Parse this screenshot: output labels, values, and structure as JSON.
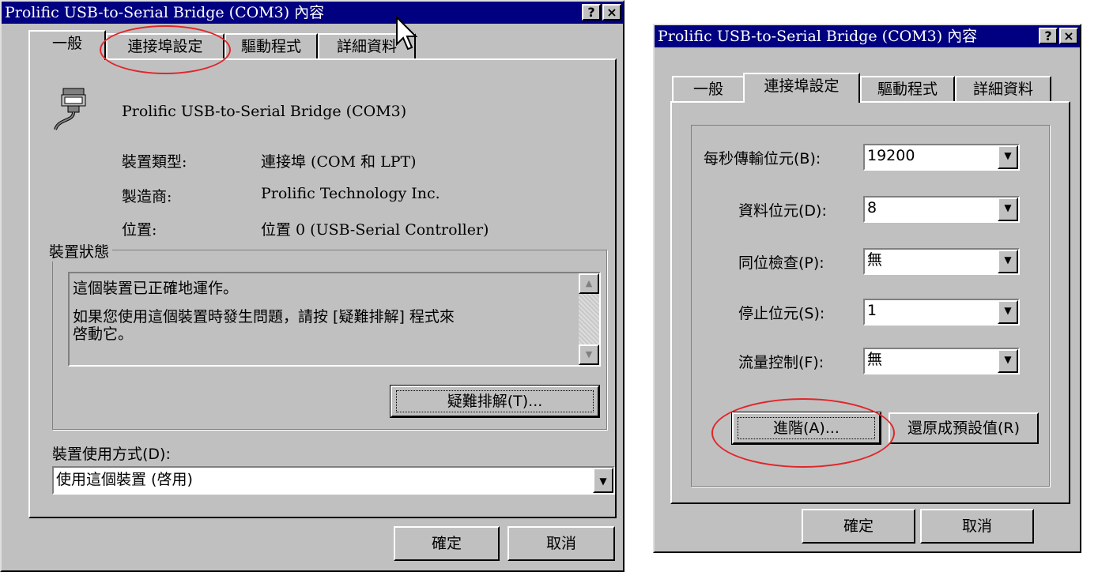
{
  "left": {
    "title": "Prolific USB-to-Serial Bridge (COM3) 內容",
    "help_btn": "?",
    "close_btn": "×",
    "tabs": [
      "一般",
      "連接埠設定",
      "驅動程式",
      "詳細資料"
    ],
    "device_name": "Prolific USB-to-Serial Bridge (COM3)",
    "props": [
      {
        "label": "裝置類型:",
        "value": "連接埠 (COM 和 LPT)"
      },
      {
        "label": "製造商:",
        "value": "Prolific Technology Inc."
      },
      {
        "label": "位置:",
        "value": "位置 0 (USB-Serial Controller)"
      }
    ],
    "status_group": "裝置狀態",
    "status_line1": "這個裝置已正確地運作。",
    "status_line2": "如果您使用這個裝置時發生問題，請按 [疑難排解] 程式來",
    "status_line3": "啓動它。",
    "troubleshoot_btn": "疑難排解(T)...",
    "usage_label": "裝置使用方式(D):",
    "usage_value": "使用這個裝置 (啓用)",
    "ok_btn": "確定",
    "cancel_btn": "取消"
  },
  "right": {
    "title": "Prolific USB-to-Serial Bridge (COM3) 內容",
    "help_btn": "?",
    "close_btn": "×",
    "tabs": [
      "一般",
      "連接埠設定",
      "驅動程式",
      "詳細資料"
    ],
    "settings": [
      {
        "label": "每秒傳輸位元(B):",
        "value": "19200"
      },
      {
        "label": "資料位元(D):",
        "value": "8"
      },
      {
        "label": "同位檢查(P):",
        "value": "無"
      },
      {
        "label": "停止位元(S):",
        "value": "1"
      },
      {
        "label": "流量控制(F):",
        "value": "無"
      }
    ],
    "advanced_btn": "進階(A)...",
    "restore_btn": "還原成預設值(R)",
    "ok_btn": "確定",
    "cancel_btn": "取消"
  },
  "annotation_color": "#e0262a"
}
